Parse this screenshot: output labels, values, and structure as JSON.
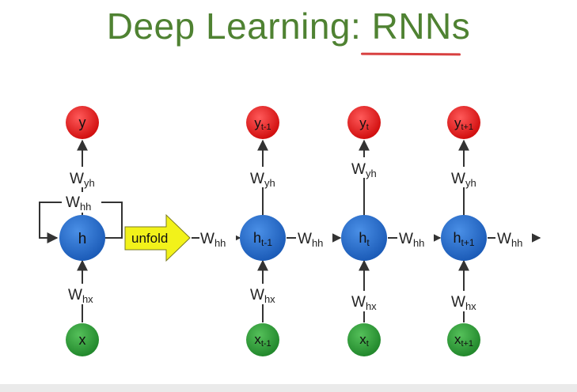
{
  "title": {
    "prefix": "Deep Learning: ",
    "highlight": "RNNs"
  },
  "accent_colors": {
    "title": "#4f8232",
    "underline": "#d84040",
    "output": "#e21a1a",
    "hidden": "#2167c4",
    "input": "#2f9a3a",
    "unfold_arrow": "#f2f21a"
  },
  "folded": {
    "output": "y",
    "hidden": "h",
    "input": "x",
    "w_yh": {
      "main": "W",
      "sub": "yh"
    },
    "w_hh": {
      "main": "W",
      "sub": "hh"
    },
    "w_hx": {
      "main": "W",
      "sub": "hx"
    }
  },
  "unfold_label": "unfold",
  "unfolded": {
    "w_hh": {
      "main": "W",
      "sub": "hh"
    },
    "steps": [
      {
        "output": {
          "main": "y",
          "sub": "t-1"
        },
        "hidden": {
          "main": "h",
          "sub": "t-1"
        },
        "input": {
          "main": "x",
          "sub": "t-1"
        },
        "w_yh": {
          "main": "W",
          "sub": "yh"
        },
        "w_hx": {
          "main": "W",
          "sub": "hx"
        }
      },
      {
        "output": {
          "main": "y",
          "sub": "t"
        },
        "hidden": {
          "main": "h",
          "sub": "t"
        },
        "input": {
          "main": "x",
          "sub": "t"
        },
        "w_yh": {
          "main": "W",
          "sub": "yh"
        },
        "w_hx": {
          "main": "W",
          "sub": "hx"
        }
      },
      {
        "output": {
          "main": "y",
          "sub": "t+1"
        },
        "hidden": {
          "main": "h",
          "sub": "t+1"
        },
        "input": {
          "main": "x",
          "sub": "t+1"
        },
        "w_yh": {
          "main": "W",
          "sub": "yh"
        },
        "w_hx": {
          "main": "W",
          "sub": "hx"
        }
      }
    ]
  }
}
